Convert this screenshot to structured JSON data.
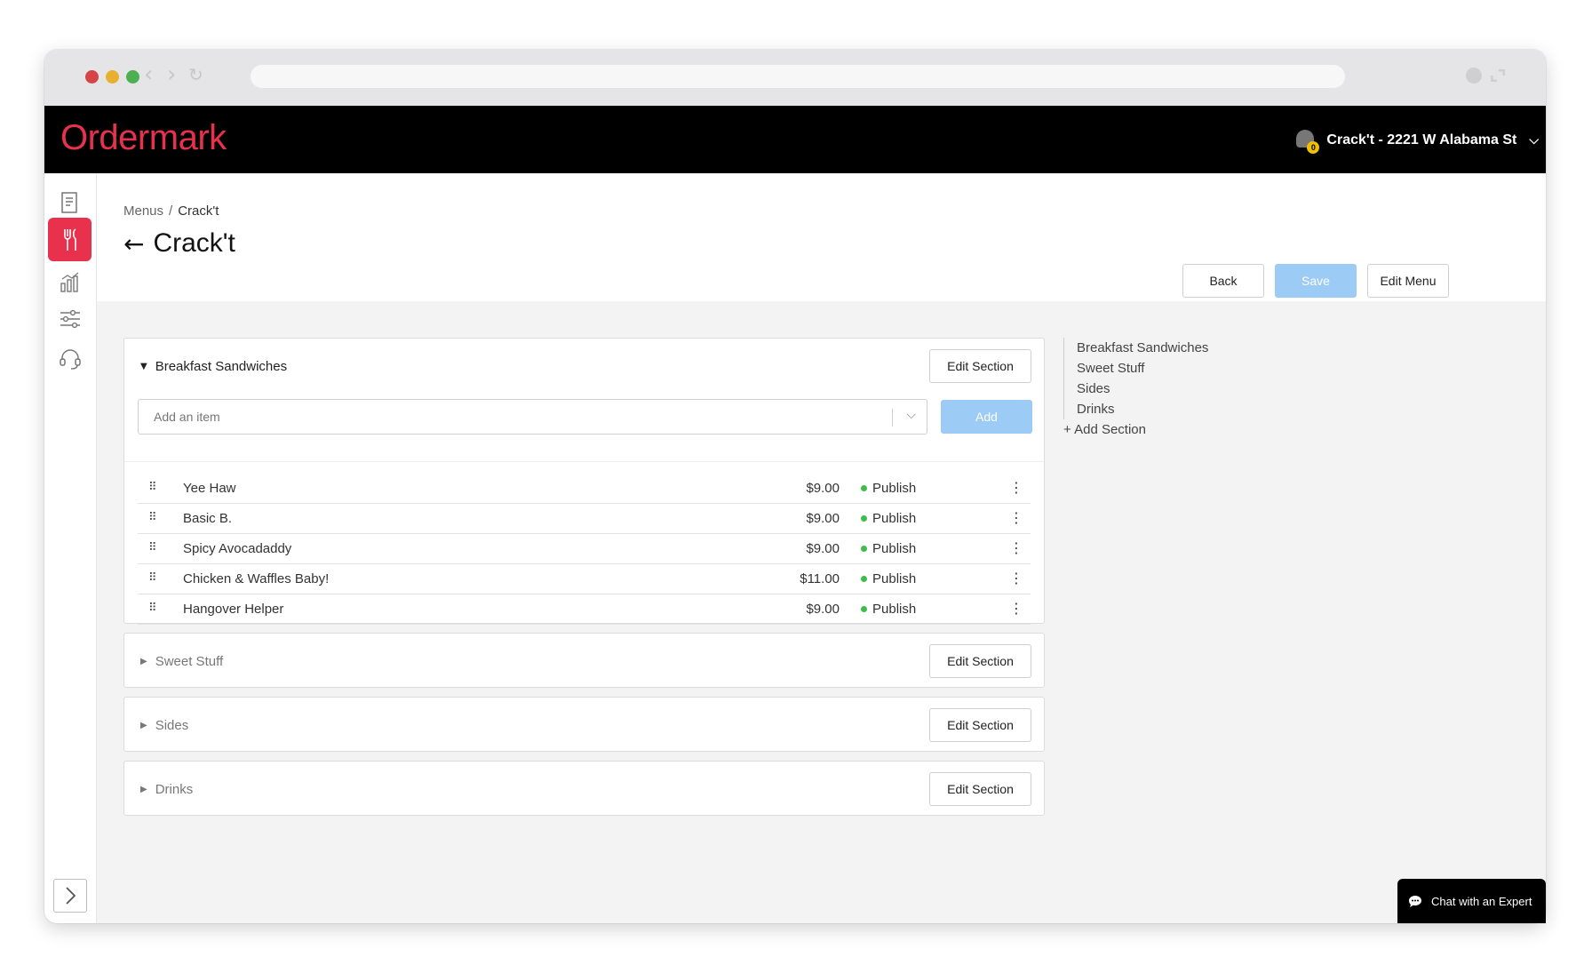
{
  "app": {
    "logo": "Ordermark",
    "store_name": "Crack't - 2221 W Alabama St",
    "notification_count": "0"
  },
  "breadcrumb": {
    "items": [
      "Menus",
      "Crack't"
    ]
  },
  "page": {
    "title": "Crack't"
  },
  "actions": {
    "back": "Back",
    "save": "Save",
    "edit_menu": "Edit Menu"
  },
  "sections": [
    {
      "name": "Breakfast Sandwiches",
      "expanded": true,
      "edit_label": "Edit Section",
      "add_placeholder": "Add an item",
      "add_label": "Add",
      "items": [
        {
          "name": "Yee Haw",
          "price": "$9.00",
          "status": "Publish"
        },
        {
          "name": "Basic B.",
          "price": "$9.00",
          "status": "Publish"
        },
        {
          "name": "Spicy Avocadaddy",
          "price": "$9.00",
          "status": "Publish"
        },
        {
          "name": "Chicken & Waffles Baby!",
          "price": "$11.00",
          "status": "Publish"
        },
        {
          "name": "Hangover Helper",
          "price": "$9.00",
          "status": "Publish"
        }
      ]
    },
    {
      "name": "Sweet Stuff",
      "expanded": false,
      "edit_label": "Edit Section"
    },
    {
      "name": "Sides",
      "expanded": false,
      "edit_label": "Edit Section"
    },
    {
      "name": "Drinks",
      "expanded": false,
      "edit_label": "Edit Section"
    }
  ],
  "outline": {
    "items": [
      "Breakfast Sandwiches",
      "Sweet Stuff",
      "Sides",
      "Drinks"
    ],
    "add_section": "+ Add Section"
  },
  "chat": {
    "label": "Chat with an Expert"
  },
  "colors": {
    "brand": "#e8314d",
    "primary_button": "#9ccbf5",
    "published": "#3dbd4a"
  }
}
